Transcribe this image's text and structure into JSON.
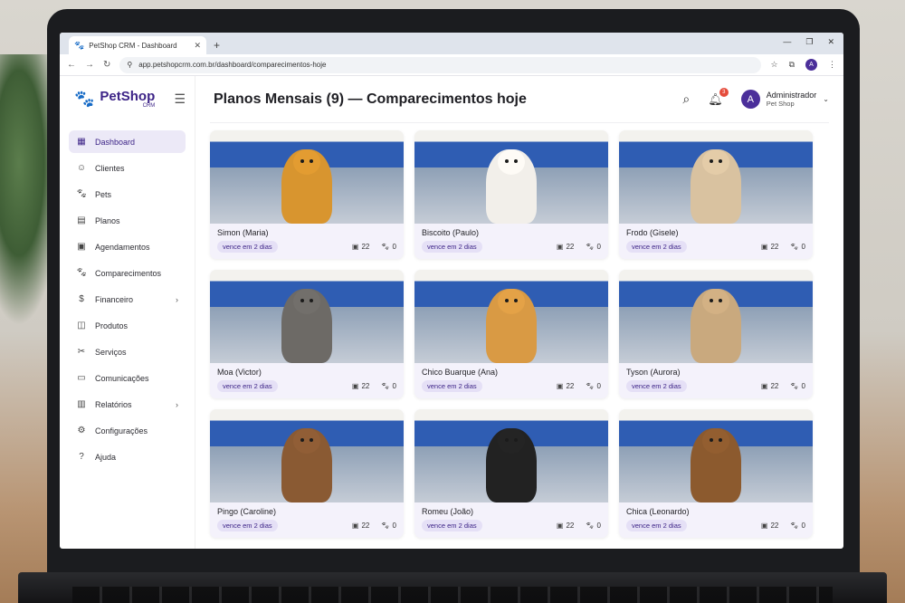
{
  "browser": {
    "tab_title": "PetShop CRM - Dashboard",
    "url": "app.petshopcrm.com.br/dashboard/comparecimentos-hoje",
    "account_initial": "A"
  },
  "brand": {
    "name": "PetShop",
    "sub": "CRM",
    "color": "#3d2487"
  },
  "sidebar": {
    "items": [
      {
        "label": "Dashboard",
        "icon": "grid-icon",
        "active": true
      },
      {
        "label": "Clientes",
        "icon": "user-icon"
      },
      {
        "label": "Pets",
        "icon": "paw-icon"
      },
      {
        "label": "Planos",
        "icon": "document-icon"
      },
      {
        "label": "Agendamentos",
        "icon": "calendar-icon"
      },
      {
        "label": "Comparecimentos",
        "icon": "paw-icon"
      },
      {
        "label": "Financeiro",
        "icon": "dollar-icon",
        "chevron": true
      },
      {
        "label": "Produtos",
        "icon": "box-icon"
      },
      {
        "label": "Serviços",
        "icon": "scissors-icon"
      },
      {
        "label": "Comunicações",
        "icon": "chat-icon"
      },
      {
        "label": "Relatórios",
        "icon": "chart-icon",
        "chevron": true
      },
      {
        "label": "Configurações",
        "icon": "gear-icon"
      },
      {
        "label": "Ajuda",
        "icon": "help-icon"
      }
    ]
  },
  "header": {
    "title": "Planos Mensais (9) — Comparecimentos hoje",
    "notifications": "3",
    "user_initial": "A",
    "user_name": "Administrador",
    "user_role": "Pet Shop"
  },
  "cards": [
    {
      "name": "Simon (Maria)",
      "due": "vence em 2 dias",
      "visits": "22",
      "pets": "0",
      "dog_color": "#d8952f"
    },
    {
      "name": "Biscoito (Paulo)",
      "due": "vence em 2 dias",
      "visits": "22",
      "pets": "0",
      "dog_color": "#f2efea"
    },
    {
      "name": "Frodo (Gisele)",
      "due": "vence em 2 dias",
      "visits": "22",
      "pets": "0",
      "dog_color": "#d9c2a0"
    },
    {
      "name": "Moa (Victor)",
      "due": "vence em 2 dias",
      "visits": "22",
      "pets": "0",
      "dog_color": "#6d6a66"
    },
    {
      "name": "Chico Buarque (Ana)",
      "due": "vence em 2 dias",
      "visits": "22",
      "pets": "0",
      "dog_color": "#d99a44"
    },
    {
      "name": "Tyson (Aurora)",
      "due": "vence em 2 dias",
      "visits": "22",
      "pets": "0",
      "dog_color": "#c9a97e"
    },
    {
      "name": "Pingo (Caroline)",
      "due": "vence em 2 dias",
      "visits": "22",
      "pets": "0",
      "dog_color": "#8a5a33"
    },
    {
      "name": "Romeu (João)",
      "due": "vence em 2 dias",
      "visits": "22",
      "pets": "0",
      "dog_color": "#222222"
    },
    {
      "name": "Chica (Leonardo)",
      "due": "vence em 2 dias",
      "visits": "22",
      "pets": "0",
      "dog_color": "#8c5a2e"
    }
  ]
}
